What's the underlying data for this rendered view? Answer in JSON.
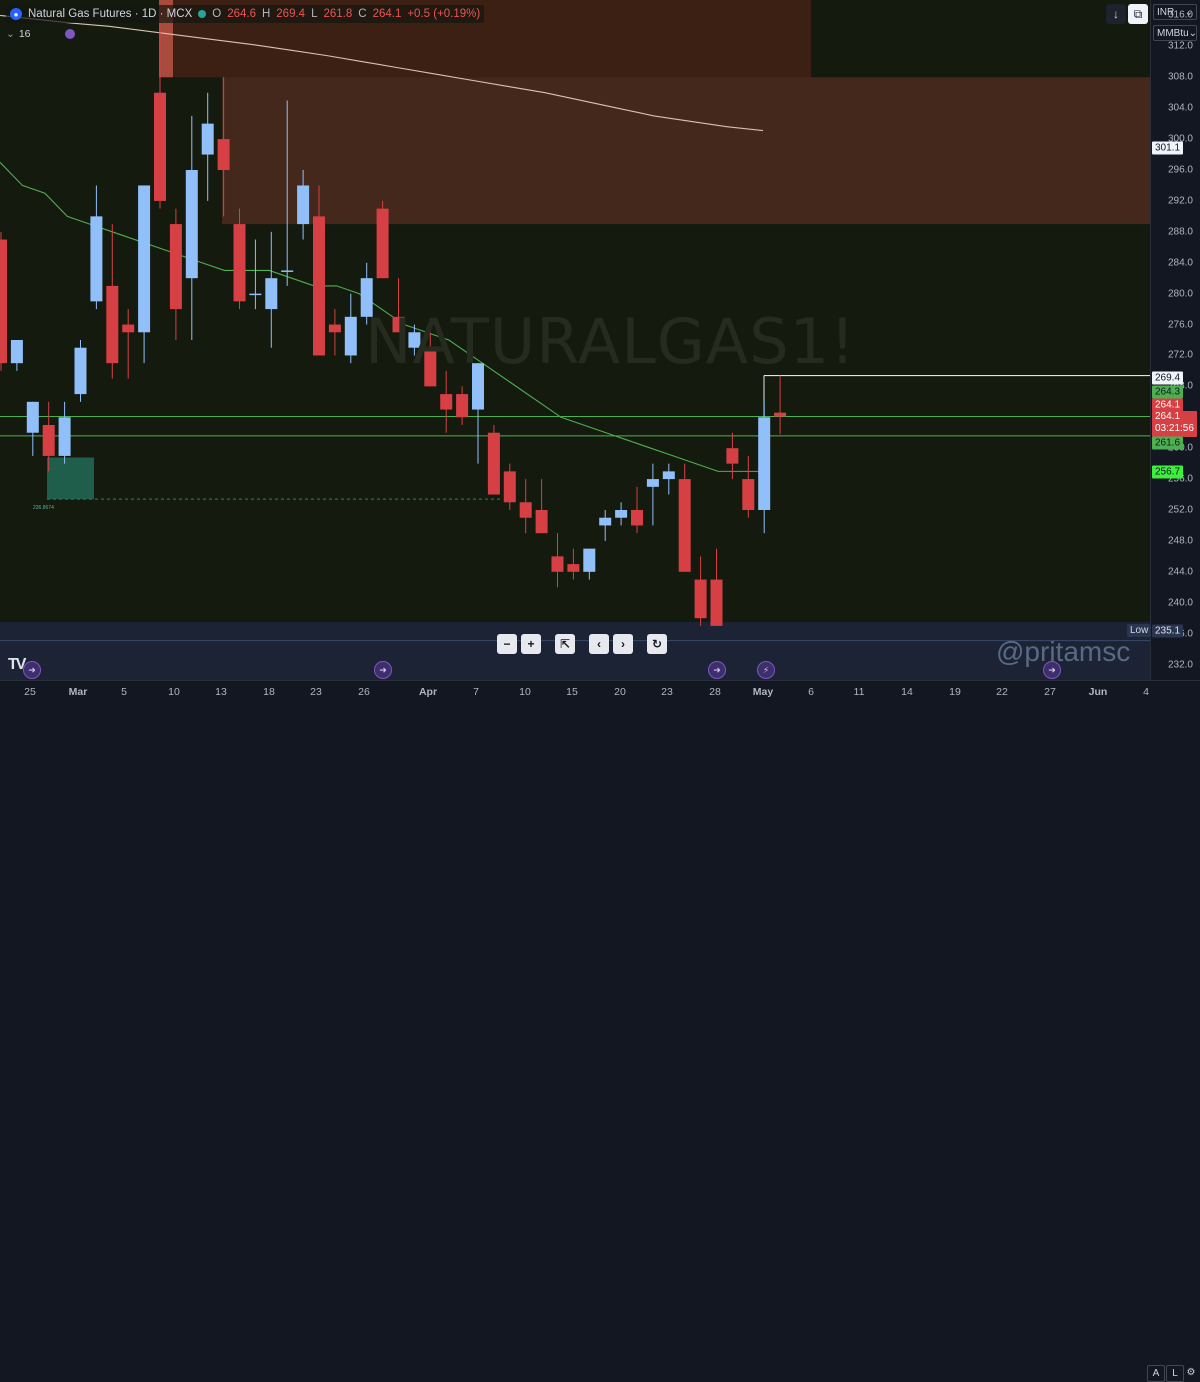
{
  "legend": {
    "symbol": "Natural Gas Futures · 1D · MCX",
    "open_lbl": "O",
    "open": "264.6",
    "high_lbl": "H",
    "high": "269.4",
    "low_lbl": "L",
    "low": "261.8",
    "close_lbl": "C",
    "close": "264.1",
    "change": "+0.5 (+0.19%)"
  },
  "indicator": {
    "value": "16"
  },
  "currency": "INR",
  "unit": "MMBtu",
  "watermark": "NATURALGAS1!",
  "handle": "@pritamsc",
  "low_label": "Low",
  "zone_label": "236.8674",
  "price_labels": {
    "p3011": "301.1",
    "p2694": "269.4",
    "p2643": "264.3",
    "p2641": "264.1",
    "countdown": "03:21:56",
    "p2616": "261.6",
    "p2567": "256.7",
    "p2351": "235.1"
  },
  "date_ticks": [
    "25",
    "Mar",
    "5",
    "10",
    "13",
    "18",
    "23",
    "26",
    "Apr",
    "7",
    "10",
    "15",
    "20",
    "23",
    "28",
    "May",
    "6",
    "11",
    "14",
    "19",
    "22",
    "27",
    "Jun",
    "4"
  ],
  "axis_buttons": {
    "auto_label": "A",
    "log_label": "L"
  },
  "icons": [
    "tradingview-logo",
    "flag-icon",
    "download-icon",
    "fullscreen-icon",
    "zoom-out-icon",
    "zoom-in-icon",
    "reset-icon",
    "alert-icon"
  ],
  "colors": {
    "up": "#90bff9",
    "down": "#d64045",
    "ma_fast": "#4caf50",
    "ma_slow": "#d8c3b5",
    "zone": "#4a2a1e",
    "support": "#1e5e4a"
  },
  "chart_data": {
    "type": "candlestick",
    "symbol": "NATURALGAS1!",
    "exchange": "MCX",
    "timeframe": "1D",
    "ylim": [
      230,
      318
    ],
    "y_ticks": [
      232,
      236,
      240,
      244,
      248,
      252,
      256,
      260,
      264,
      268,
      272,
      276,
      280,
      284,
      288,
      292,
      296,
      300,
      304,
      308,
      312,
      316
    ],
    "x_labels": [
      "25",
      "Mar",
      "5",
      "10",
      "13",
      "18",
      "23",
      "26",
      "Apr",
      "7",
      "10",
      "15",
      "20",
      "23",
      "28",
      "May",
      "6",
      "11",
      "14",
      "19",
      "22",
      "27",
      "Jun",
      "4"
    ],
    "candles": [
      {
        "o": 287.0,
        "h": 288.0,
        "l": 270.0,
        "c": 271.0
      },
      {
        "o": 271.0,
        "h": 274.0,
        "l": 270.0,
        "c": 274.0
      },
      {
        "o": 262.0,
        "h": 266.0,
        "l": 259.0,
        "c": 266.0
      },
      {
        "o": 263.0,
        "h": 266.0,
        "l": 257.0,
        "c": 259.0
      },
      {
        "o": 259.0,
        "h": 266.0,
        "l": 258.0,
        "c": 264.0
      },
      {
        "o": 267.0,
        "h": 274.0,
        "l": 266.0,
        "c": 273.0
      },
      {
        "o": 279.0,
        "h": 294.0,
        "l": 278.0,
        "c": 290.0
      },
      {
        "o": 281.0,
        "h": 289.0,
        "l": 269.0,
        "c": 271.0
      },
      {
        "o": 276.0,
        "h": 278.0,
        "l": 269.0,
        "c": 275.0
      },
      {
        "o": 275.0,
        "h": 290.0,
        "l": 271.0,
        "c": 294.0
      },
      {
        "o": 306.0,
        "h": 317.0,
        "l": 291.0,
        "c": 292.0
      },
      {
        "o": 289.0,
        "h": 291.0,
        "l": 274.0,
        "c": 278.0
      },
      {
        "o": 282.0,
        "h": 303.0,
        "l": 274.0,
        "c": 296.0
      },
      {
        "o": 298.0,
        "h": 306.0,
        "l": 292.0,
        "c": 302.0
      },
      {
        "o": 300.0,
        "h": 308.0,
        "l": 290.0,
        "c": 296.0
      },
      {
        "o": 289.0,
        "h": 291.0,
        "l": 278.0,
        "c": 279.0
      },
      {
        "o": 280.0,
        "h": 287.0,
        "l": 278.0,
        "c": 280.0
      },
      {
        "o": 278.0,
        "h": 288.0,
        "l": 273.0,
        "c": 282.0
      },
      {
        "o": 283.0,
        "h": 305.0,
        "l": 281.0,
        "c": 283.0
      },
      {
        "o": 289.0,
        "h": 296.0,
        "l": 287.0,
        "c": 294.0
      },
      {
        "o": 290.0,
        "h": 294.0,
        "l": 276.0,
        "c": 272.0
      },
      {
        "o": 276.0,
        "h": 278.0,
        "l": 272.0,
        "c": 275.0
      },
      {
        "o": 272.0,
        "h": 280.0,
        "l": 271.0,
        "c": 277.0
      },
      {
        "o": 277.0,
        "h": 284.0,
        "l": 276.0,
        "c": 282.0
      },
      {
        "o": 291.0,
        "h": 292.0,
        "l": 282.0,
        "c": 282.0
      },
      {
        "o": 277.0,
        "h": 282.0,
        "l": 275.0,
        "c": 275.0
      },
      {
        "o": 273.0,
        "h": 276.0,
        "l": 272.0,
        "c": 275.0
      },
      {
        "o": 273.0,
        "h": 275.0,
        "l": 268.0,
        "c": 268.0
      },
      {
        "o": 267.0,
        "h": 270.0,
        "l": 262.0,
        "c": 265.0
      },
      {
        "o": 267.0,
        "h": 268.0,
        "l": 263.0,
        "c": 264.0
      },
      {
        "o": 265.0,
        "h": 270.0,
        "l": 258.0,
        "c": 271.0
      },
      {
        "o": 262.0,
        "h": 263.0,
        "l": 254.0,
        "c": 254.0
      },
      {
        "o": 257.0,
        "h": 258.0,
        "l": 252.0,
        "c": 253.0
      },
      {
        "o": 253.0,
        "h": 256.0,
        "l": 249.0,
        "c": 251.0
      },
      {
        "o": 252.0,
        "h": 256.0,
        "l": 249.0,
        "c": 249.0
      },
      {
        "o": 246.0,
        "h": 249.0,
        "l": 242.0,
        "c": 244.0
      },
      {
        "o": 245.0,
        "h": 247.0,
        "l": 243.0,
        "c": 244.0
      },
      {
        "o": 244.0,
        "h": 246.0,
        "l": 243.0,
        "c": 247.0
      },
      {
        "o": 250.0,
        "h": 252.0,
        "l": 248.0,
        "c": 251.0
      },
      {
        "o": 251.0,
        "h": 253.0,
        "l": 250.0,
        "c": 252.0
      },
      {
        "o": 252.0,
        "h": 255.0,
        "l": 249.0,
        "c": 250.0
      },
      {
        "o": 255.0,
        "h": 258.0,
        "l": 250.0,
        "c": 256.0
      },
      {
        "o": 256.0,
        "h": 258.0,
        "l": 254.0,
        "c": 257.0
      },
      {
        "o": 256.0,
        "h": 258.0,
        "l": 244.0,
        "c": 244.0
      },
      {
        "o": 243.0,
        "h": 246.0,
        "l": 237.0,
        "c": 238.0
      },
      {
        "o": 243.0,
        "h": 247.0,
        "l": 237.0,
        "c": 237.0
      },
      {
        "o": 260.0,
        "h": 262.0,
        "l": 256.0,
        "c": 258.0
      },
      {
        "o": 256.0,
        "h": 259.0,
        "l": 251.0,
        "c": 252.0
      },
      {
        "o": 252.0,
        "h": 266.0,
        "l": 249.0,
        "c": 264.0
      },
      {
        "o": 264.6,
        "h": 269.4,
        "l": 261.8,
        "c": 264.1
      }
    ],
    "ma_fast": [
      297,
      294,
      293,
      290,
      289,
      288,
      287,
      286,
      285,
      284,
      283,
      283,
      283,
      282,
      281,
      281,
      280,
      278,
      276,
      275,
      274,
      272,
      270,
      268,
      266,
      264,
      263,
      262,
      261,
      260,
      259,
      258,
      257,
      257,
      257
    ],
    "ma_slow": [
      316,
      315.5,
      315,
      314.6,
      314,
      313.4,
      312.8,
      312.2,
      311.5,
      310.8,
      310,
      309.2,
      308.4,
      307.6,
      306.8,
      306,
      305,
      304,
      303,
      302.3,
      301.6,
      301.1
    ],
    "levels": [
      {
        "price": 261.6,
        "color": "#4caf50"
      },
      {
        "price": 264.1,
        "color": "#4caf50"
      },
      {
        "price": 269.4,
        "color": "#e0e3eb"
      }
    ],
    "zones": [
      {
        "from": 308,
        "to": 318
      },
      {
        "from": 289,
        "to": 308
      }
    ],
    "support_zone": {
      "from": 253.4,
      "to": 258.8
    },
    "low_marker": 235.1
  }
}
